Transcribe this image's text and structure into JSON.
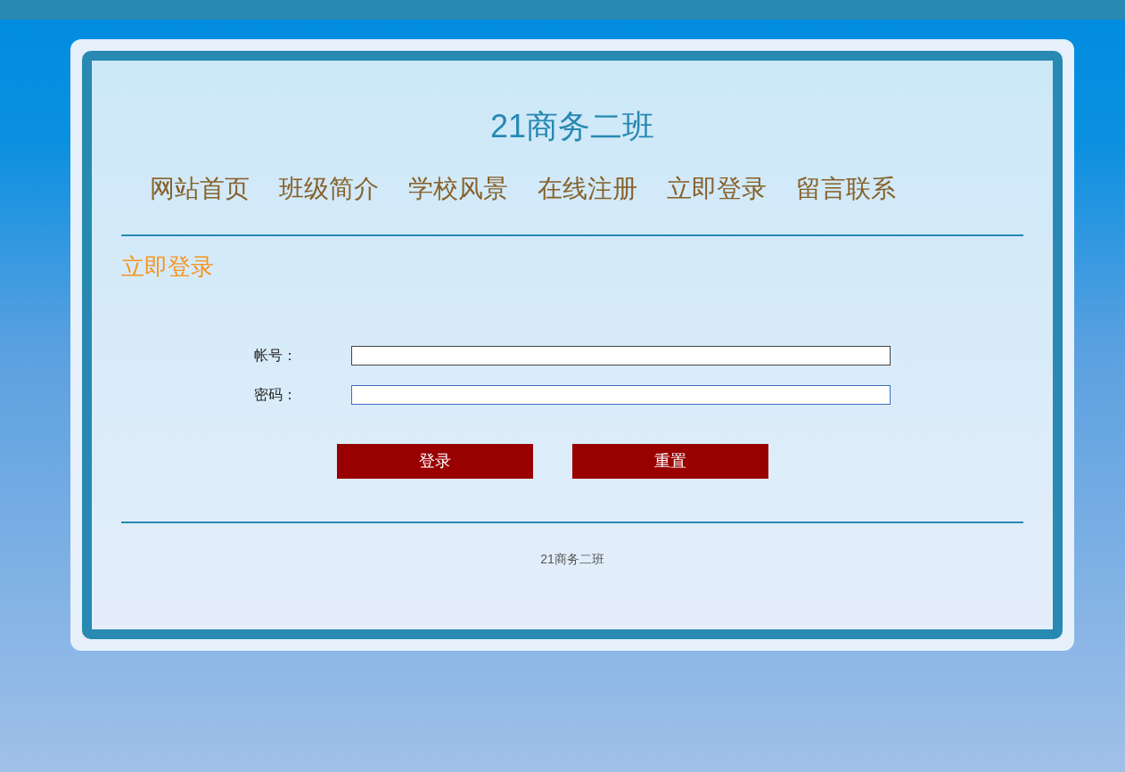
{
  "site_title": "21商务二班",
  "nav": [
    {
      "label": "网站首页"
    },
    {
      "label": "班级简介"
    },
    {
      "label": "学校风景"
    },
    {
      "label": "在线注册"
    },
    {
      "label": "立即登录"
    },
    {
      "label": "留言联系"
    }
  ],
  "section_title": "立即登录",
  "fields": [
    {
      "label": "帐号：",
      "focused": false
    },
    {
      "label": "密码：",
      "focused": true
    }
  ],
  "buttons": [
    "登录",
    "重置"
  ],
  "footer": "21商务二班"
}
